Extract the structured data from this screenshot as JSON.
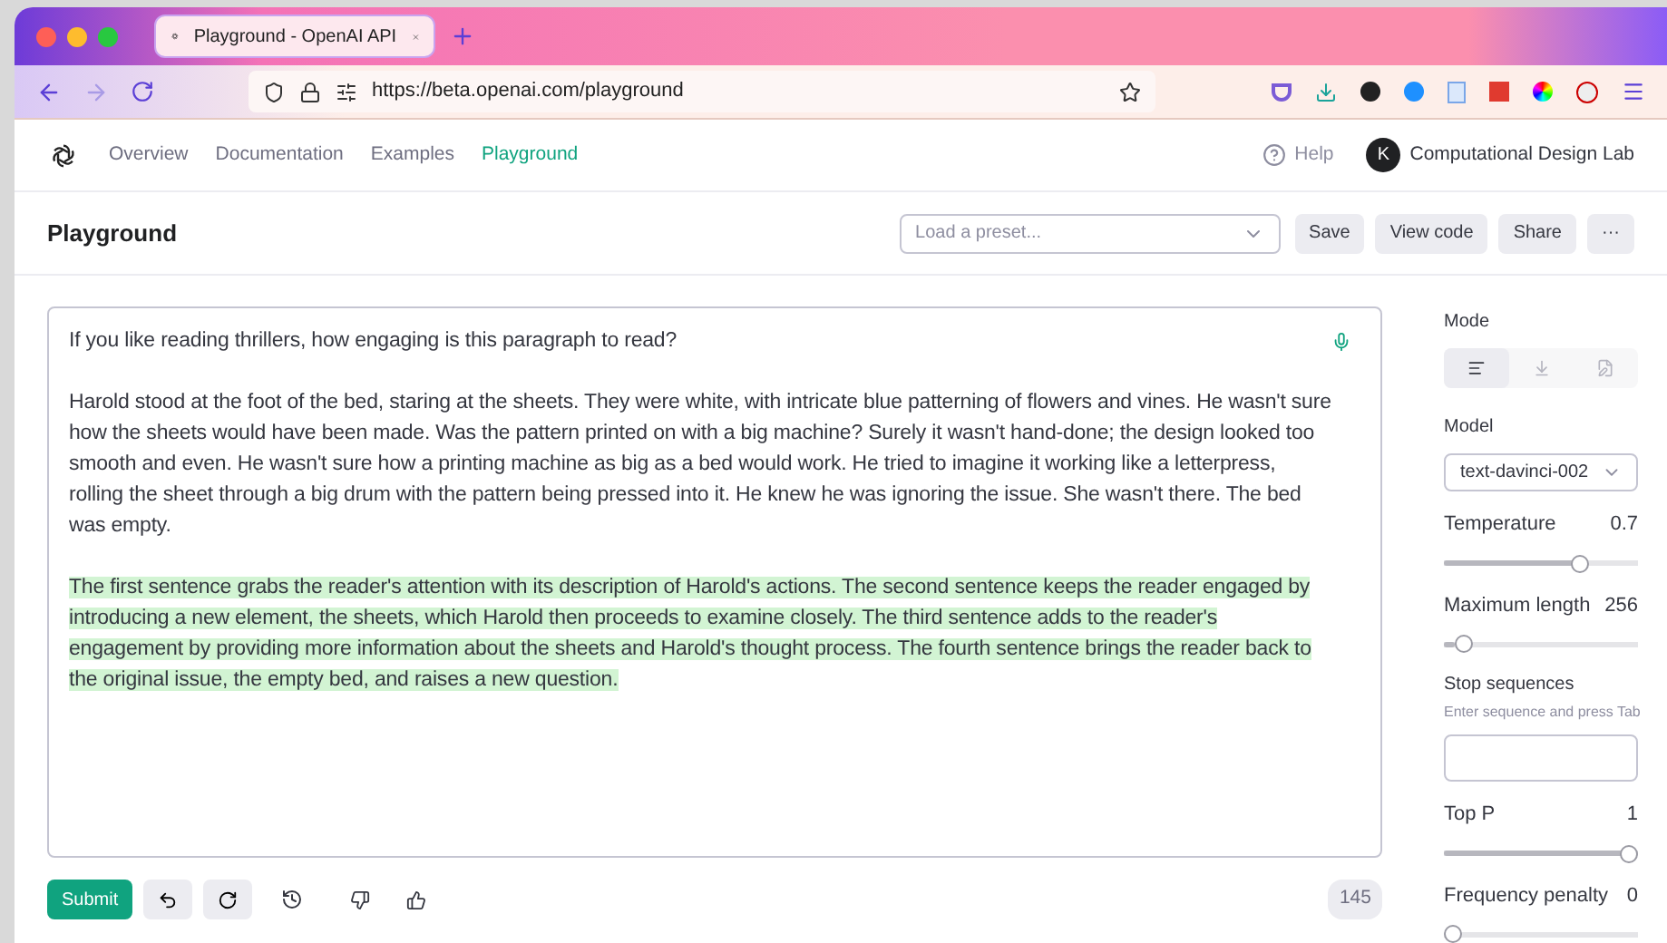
{
  "browser": {
    "tab_title": "Playground - OpenAI API",
    "url": "https://beta.openai.com/playground"
  },
  "nav": {
    "links": [
      {
        "label": "Overview",
        "selected": false
      },
      {
        "label": "Documentation",
        "selected": false
      },
      {
        "label": "Examples",
        "selected": false
      },
      {
        "label": "Playground",
        "selected": true
      }
    ],
    "help": "Help",
    "avatar_initial": "K",
    "org": "Computational Design Lab"
  },
  "header": {
    "title": "Playground",
    "preset": {
      "placeholder": "Load a preset..."
    },
    "buttons": [
      "Save",
      "View code",
      "Share",
      "···"
    ]
  },
  "prompt": {
    "paragraphs": [
      {
        "text": "If you like reading thrillers, how engaging is this paragraph to read?",
        "highlighted": false
      },
      {
        "text": "Harold stood at the foot of the bed, staring at the sheets. They were white, with intricate blue patterning of flowers and vines. He wasn't sure how the sheets would have been made. Was the pattern printed on with a big machine? Surely it wasn't hand-done; the design looked too smooth and even. He wasn't sure how a printing machine as big as a bed would work. He tried to imagine it working like a letterpress, rolling the sheet through a big drum with the pattern being pressed into it. He knew he was ignoring the issue. She wasn't there. The bed was empty.",
        "highlighted": false
      },
      {
        "text": "The first sentence grabs the reader's attention with its description of Harold's actions. The second sentence keeps the reader engaged by introducing a new element, the sheets, which Harold then proceeds to examine closely. The third sentence adds to the reader's engagement by providing more information about the sheets and Harold's thought process. The fourth sentence brings the reader back to the original issue, the empty bed, and raises a new question.",
        "highlighted": true
      }
    ]
  },
  "footer": {
    "submit": "Submit",
    "token_count": "145"
  },
  "settings": {
    "mode_label": "Mode",
    "modes": [
      {
        "kind": "complete",
        "selected": true
      },
      {
        "kind": "insert",
        "selected": false
      },
      {
        "kind": "edit",
        "selected": false
      }
    ],
    "model_label": "Model",
    "model": "text-davinci-002",
    "sliders": [
      {
        "name": "Temperature",
        "reading": "0.7",
        "level": 0.72
      },
      {
        "name": "Maximum length",
        "reading": "256",
        "level": 0.06
      }
    ],
    "stop": {
      "label": "Stop sequences",
      "hint": "Enter sequence and press Tab"
    },
    "sliders2": [
      {
        "name": "Top P",
        "reading": "1",
        "level": 1
      },
      {
        "name": "Frequency penalty",
        "reading": "0",
        "level": 0
      }
    ]
  }
}
